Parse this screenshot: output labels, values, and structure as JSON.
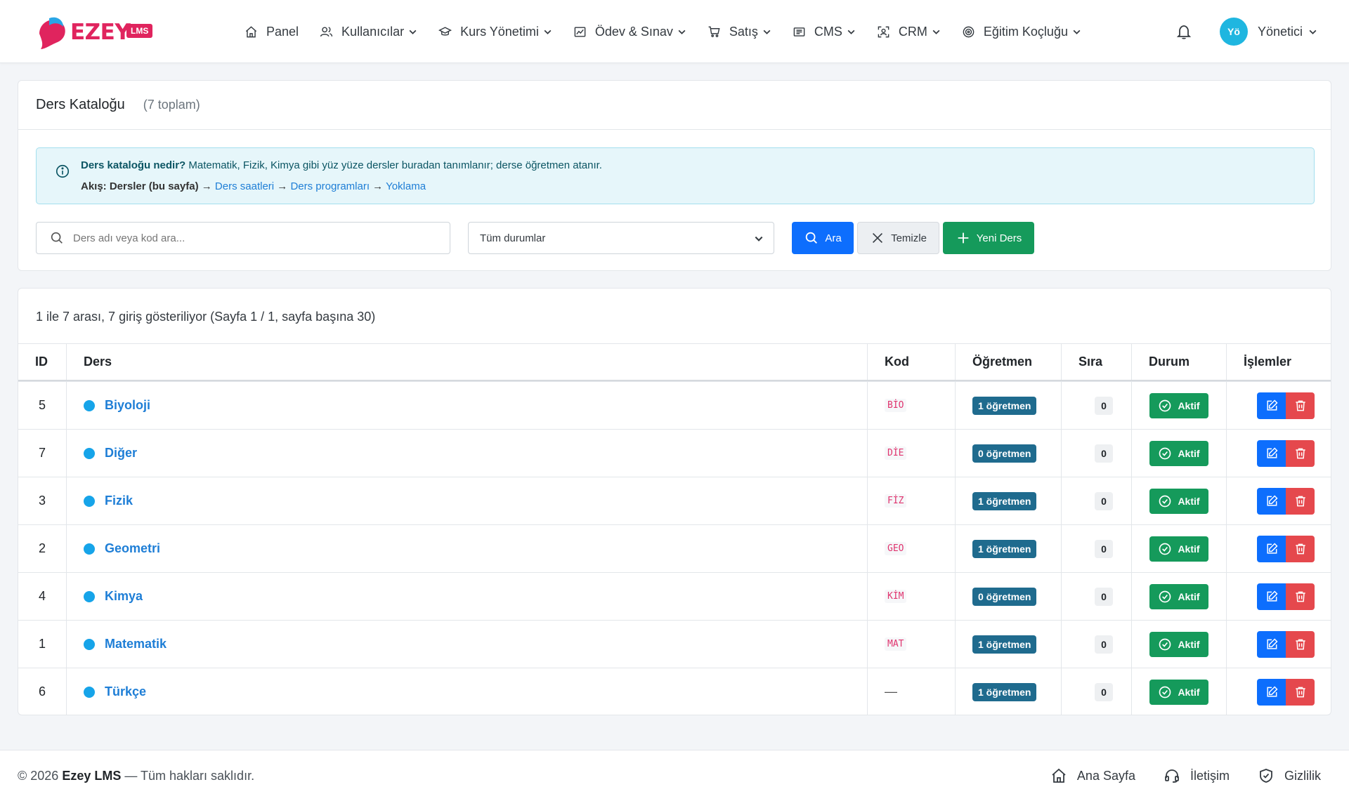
{
  "app": {
    "logo_text": "EZEY",
    "logo_badge": "LMS"
  },
  "nav": {
    "items": [
      {
        "label": "Panel",
        "icon": "home-icon",
        "dropdown": false
      },
      {
        "label": "Kullanıcılar",
        "icon": "users-icon",
        "dropdown": true
      },
      {
        "label": "Kurs Yönetimi",
        "icon": "graduation-cap-icon",
        "dropdown": true
      },
      {
        "label": "Ödev & Sınav",
        "icon": "image-chart-icon",
        "dropdown": true
      },
      {
        "label": "Satış",
        "icon": "cart-icon",
        "dropdown": true
      },
      {
        "label": "CMS",
        "icon": "newspaper-icon",
        "dropdown": true
      },
      {
        "label": "CRM",
        "icon": "person-scan-icon",
        "dropdown": true
      },
      {
        "label": "Eğitim Koçluğu",
        "icon": "target-icon",
        "dropdown": true
      }
    ]
  },
  "user": {
    "initials": "Yö",
    "name": "Yönetici",
    "avatar_color": "#1fb6e0"
  },
  "catalog": {
    "title": "Ders Kataloğu",
    "total": "(7 toplam)",
    "info": {
      "q_bold": "Ders kataloğu nedir?",
      "q_text": " Matematik, Fizik, Kimya gibi yüz yüze dersler buradan tanımlanır; derse öğretmen atanır.",
      "flow_bold": "Akış: Dersler (bu sayfa)",
      "arrow": " → ",
      "flow_links": [
        "Ders saatleri",
        "Ders programları",
        "Yoklama"
      ]
    },
    "search_placeholder": "Ders adı veya kod ara...",
    "status_select": "Tüm durumlar",
    "btn_search": "Ara",
    "btn_clear": "Temizle",
    "btn_new": "Yeni Ders"
  },
  "list": {
    "summary": "1 ile 7 arası, 7 giriş gösteriliyor (Sayfa 1 / 1, sayfa başına 30)",
    "columns": [
      "ID",
      "Ders",
      "Kod",
      "Öğretmen",
      "Sıra",
      "Durum",
      "İşlemler"
    ],
    "rows": [
      {
        "id": "5",
        "name": "Biyoloji",
        "code": "BİO",
        "teachers": "1 öğretmen",
        "order": "0",
        "status": "Aktif"
      },
      {
        "id": "7",
        "name": "Diğer",
        "code": "DİE",
        "teachers": "0 öğretmen",
        "order": "0",
        "status": "Aktif"
      },
      {
        "id": "3",
        "name": "Fizik",
        "code": "FİZ",
        "teachers": "1 öğretmen",
        "order": "0",
        "status": "Aktif"
      },
      {
        "id": "2",
        "name": "Geometri",
        "code": "GEO",
        "teachers": "1 öğretmen",
        "order": "0",
        "status": "Aktif"
      },
      {
        "id": "4",
        "name": "Kimya",
        "code": "KİM",
        "teachers": "0 öğretmen",
        "order": "0",
        "status": "Aktif"
      },
      {
        "id": "1",
        "name": "Matematik",
        "code": "MAT",
        "teachers": "1 öğretmen",
        "order": "0",
        "status": "Aktif"
      },
      {
        "id": "6",
        "name": "Türkçe",
        "code": "—",
        "teachers": "1 öğretmen",
        "order": "0",
        "status": "Aktif"
      }
    ]
  },
  "footer": {
    "copy_prefix": "© 2026 ",
    "brand": "Ezey LMS",
    "copy_suffix": " — Tüm hakları saklıdır.",
    "links": [
      {
        "label": "Ana Sayfa",
        "icon": "home-icon"
      },
      {
        "label": "İletişim",
        "icon": "headset-icon"
      },
      {
        "label": "Gizlilik",
        "icon": "shield-check-icon"
      }
    ]
  },
  "colors": {
    "primary": "#0d6efd",
    "success": "#159a5b",
    "danger": "#e5484d",
    "brand": "#e0245e",
    "link": "#1e7ed6"
  }
}
